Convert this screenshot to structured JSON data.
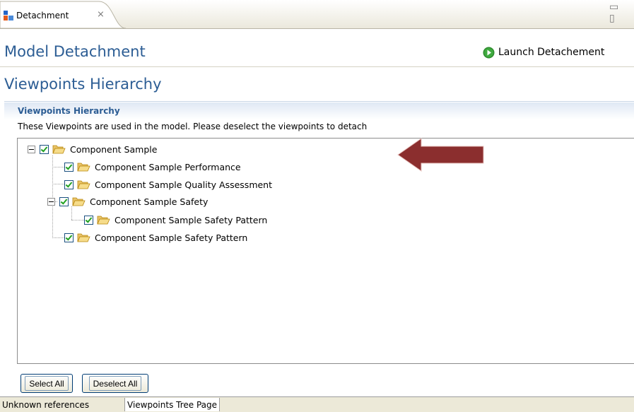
{
  "editor_tab": {
    "label": "Detachment",
    "close_glyph": "⨯"
  },
  "window_controls": "▭ ▯",
  "header": {
    "title": "Model Detachment",
    "launch_label": "Launch Detachement"
  },
  "page": {
    "title": "Viewpoints Hierarchy"
  },
  "section": {
    "title": "Viewpoints Hierarchy",
    "description": "These Viewpoints are used in the model. Please deselect the viewpoints to detach"
  },
  "tree": [
    {
      "label": "Component Sample",
      "checked": true,
      "level": 0,
      "expandable": true
    },
    {
      "label": "Component Sample Performance",
      "checked": true,
      "level": 1,
      "expandable": false
    },
    {
      "label": "Component Sample Quality Assessment",
      "checked": true,
      "level": 1,
      "expandable": false
    },
    {
      "label": "Component Sample Safety",
      "checked": true,
      "level": 1,
      "expandable": true
    },
    {
      "label": "Component Sample Safety Pattern",
      "checked": true,
      "level": 2,
      "expandable": false
    },
    {
      "label": "Component Sample Safety Pattern",
      "checked": true,
      "level": 1,
      "expandable": false
    }
  ],
  "buttons": {
    "select_all": "Select All",
    "deselect_all": "Deselect All"
  },
  "bottom_tabs": [
    {
      "label": "Unknown references",
      "active": false
    },
    {
      "label": "Viewpoints Tree Page",
      "active": true
    }
  ],
  "colors": {
    "title_blue": "#2c5d94",
    "arrow_red": "#8b2e2e",
    "check_green": "#21a121"
  }
}
